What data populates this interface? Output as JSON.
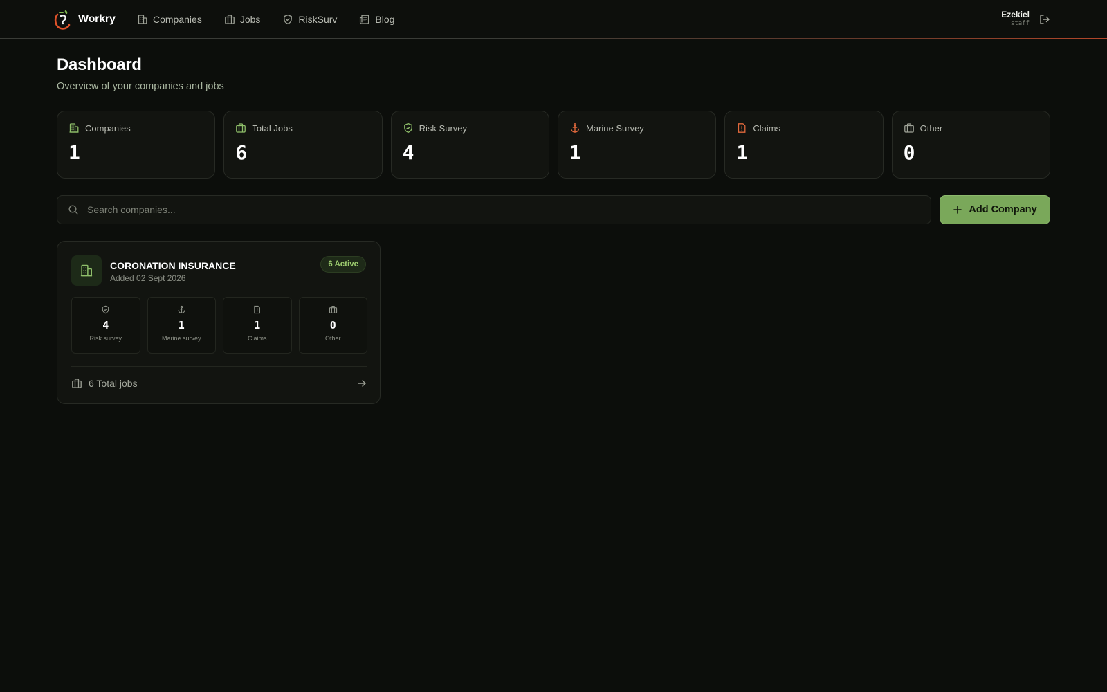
{
  "app": {
    "brand": "Workry",
    "nav": [
      {
        "label": "Companies",
        "icon": "building-icon"
      },
      {
        "label": "Jobs",
        "icon": "briefcase-icon"
      },
      {
        "label": "RiskSurv",
        "icon": "shield-icon"
      },
      {
        "label": "Blog",
        "icon": "newspaper-icon"
      }
    ],
    "user": {
      "name": "Ezekiel",
      "role": "staff"
    }
  },
  "page": {
    "title": "Dashboard",
    "subtitle": "Overview of your companies and jobs"
  },
  "stats": [
    {
      "label": "Companies",
      "value": "1",
      "icon": "building-icon",
      "color": "#8fbf6a"
    },
    {
      "label": "Total Jobs",
      "value": "6",
      "icon": "briefcase-icon",
      "color": "#8fbf6a"
    },
    {
      "label": "Risk Survey",
      "value": "4",
      "icon": "shield-check-icon",
      "color": "#8fbf6a"
    },
    {
      "label": "Marine Survey",
      "value": "1",
      "icon": "anchor-icon",
      "color": "#e0683c"
    },
    {
      "label": "Claims",
      "value": "1",
      "icon": "file-alert-icon",
      "color": "#e0683c"
    },
    {
      "label": "Other",
      "value": "0",
      "icon": "briefcase-icon",
      "color": "#9ea297"
    }
  ],
  "search": {
    "placeholder": "Search companies..."
  },
  "add_button": {
    "label": "Add Company"
  },
  "companies": [
    {
      "name": "CORONATION INSURANCE",
      "added": "Added 02 Sept 2026",
      "badge": "6 Active",
      "metrics": [
        {
          "label": "Risk survey",
          "value": "4",
          "icon": "shield-check-icon"
        },
        {
          "label": "Marine survey",
          "value": "1",
          "icon": "anchor-icon"
        },
        {
          "label": "Claims",
          "value": "1",
          "icon": "file-alert-icon"
        },
        {
          "label": "Other",
          "value": "0",
          "icon": "briefcase-icon"
        }
      ],
      "total_jobs": "6 Total jobs"
    }
  ],
  "colors": {
    "accent": "#7aa85a",
    "background": "#0c0e0b",
    "card": "#121410",
    "warning": "#e0683c"
  }
}
